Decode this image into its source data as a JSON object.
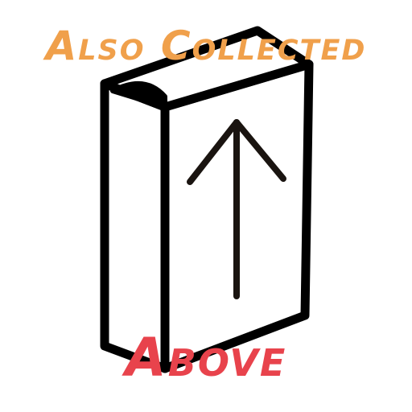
{
  "caption_top": {
    "text": "Also Collected",
    "color": "#f0a04b"
  },
  "caption_bottom": {
    "text": "Above",
    "color": "#e8434c"
  },
  "icon": {
    "name": "book-with-up-arrow-icon",
    "stroke_color": "#000000",
    "arrow_color": "#1a1410"
  }
}
